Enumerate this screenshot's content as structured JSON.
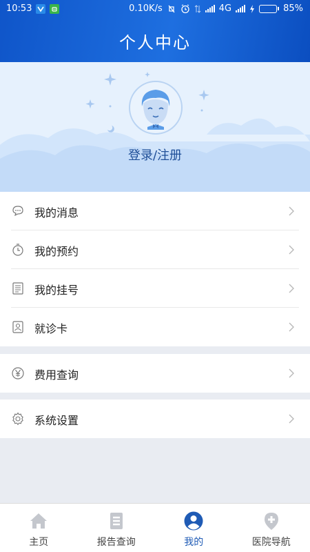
{
  "status_bar": {
    "time": "10:53",
    "net_speed": "0.10K/s",
    "network": "4G",
    "battery": "85%",
    "battery_level": 0.85,
    "battery_color": "#3ee05a"
  },
  "header": {
    "title": "个人中心",
    "color": "#1e6fe0"
  },
  "profile": {
    "login_text": "登录/注册"
  },
  "menu": {
    "group1": [
      {
        "label": "我的消息",
        "icon": "chat-bubble-icon"
      },
      {
        "label": "我的预约",
        "icon": "clock-icon"
      },
      {
        "label": "我的挂号",
        "icon": "list-document-icon"
      },
      {
        "label": "就诊卡",
        "icon": "id-card-icon"
      }
    ],
    "group2": [
      {
        "label": "费用查询",
        "icon": "yen-icon"
      }
    ],
    "group3": [
      {
        "label": "系统设置",
        "icon": "gear-icon"
      }
    ]
  },
  "tabbar": {
    "active_color": "#1f5bb5",
    "items": [
      {
        "label": "主页",
        "icon": "home-icon",
        "active": false
      },
      {
        "label": "报告查询",
        "icon": "report-icon",
        "active": false
      },
      {
        "label": "我的",
        "icon": "user-icon",
        "active": true
      },
      {
        "label": "医院导航",
        "icon": "location-cross-icon",
        "active": false
      }
    ]
  }
}
